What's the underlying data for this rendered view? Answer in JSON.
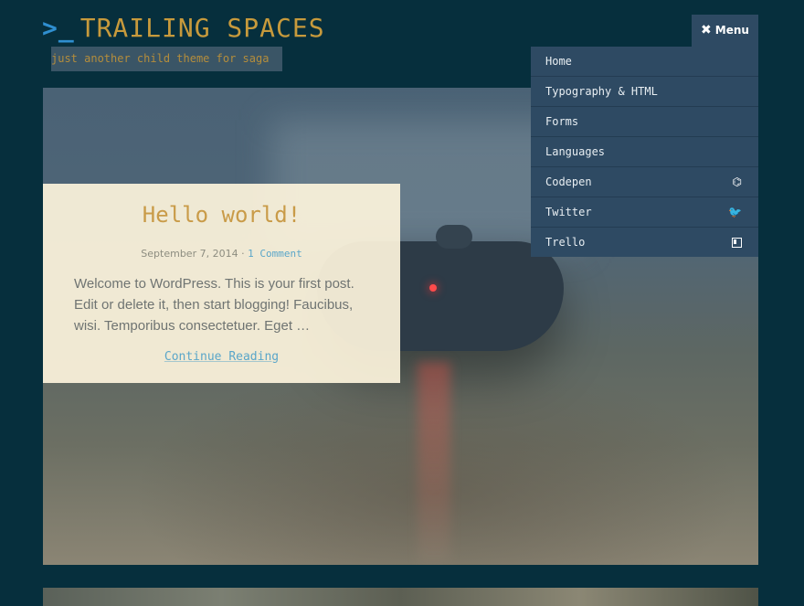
{
  "header": {
    "prompt": ">_",
    "title": "TRAILING SPACES",
    "tagline": "just another child theme for saga"
  },
  "menu": {
    "toggle_icon": "close-x-icon",
    "toggle_label": "Menu",
    "items": [
      {
        "label": "Home",
        "icon": ""
      },
      {
        "label": "Typography & HTML",
        "icon": ""
      },
      {
        "label": "Forms",
        "icon": ""
      },
      {
        "label": "Languages",
        "icon": ""
      },
      {
        "label": "Codepen",
        "icon": "codepen-icon"
      },
      {
        "label": "Twitter",
        "icon": "twitter-icon"
      },
      {
        "label": "Trello",
        "icon": "trello-icon"
      }
    ]
  },
  "post": {
    "title": "Hello world!",
    "date": "September 7, 2014",
    "separator": "·",
    "comments": "1 Comment",
    "excerpt": "Welcome to WordPress. This is your first post. Edit or delete it, then start blogging! Faucibus, wisi. Temporibus consectetuer. Eget …",
    "read_more": "Continue Reading"
  },
  "colors": {
    "background": "#062f3d",
    "title": "#c79a3c",
    "menu_bg": "#2e4a63",
    "link": "#5aa6c9"
  }
}
